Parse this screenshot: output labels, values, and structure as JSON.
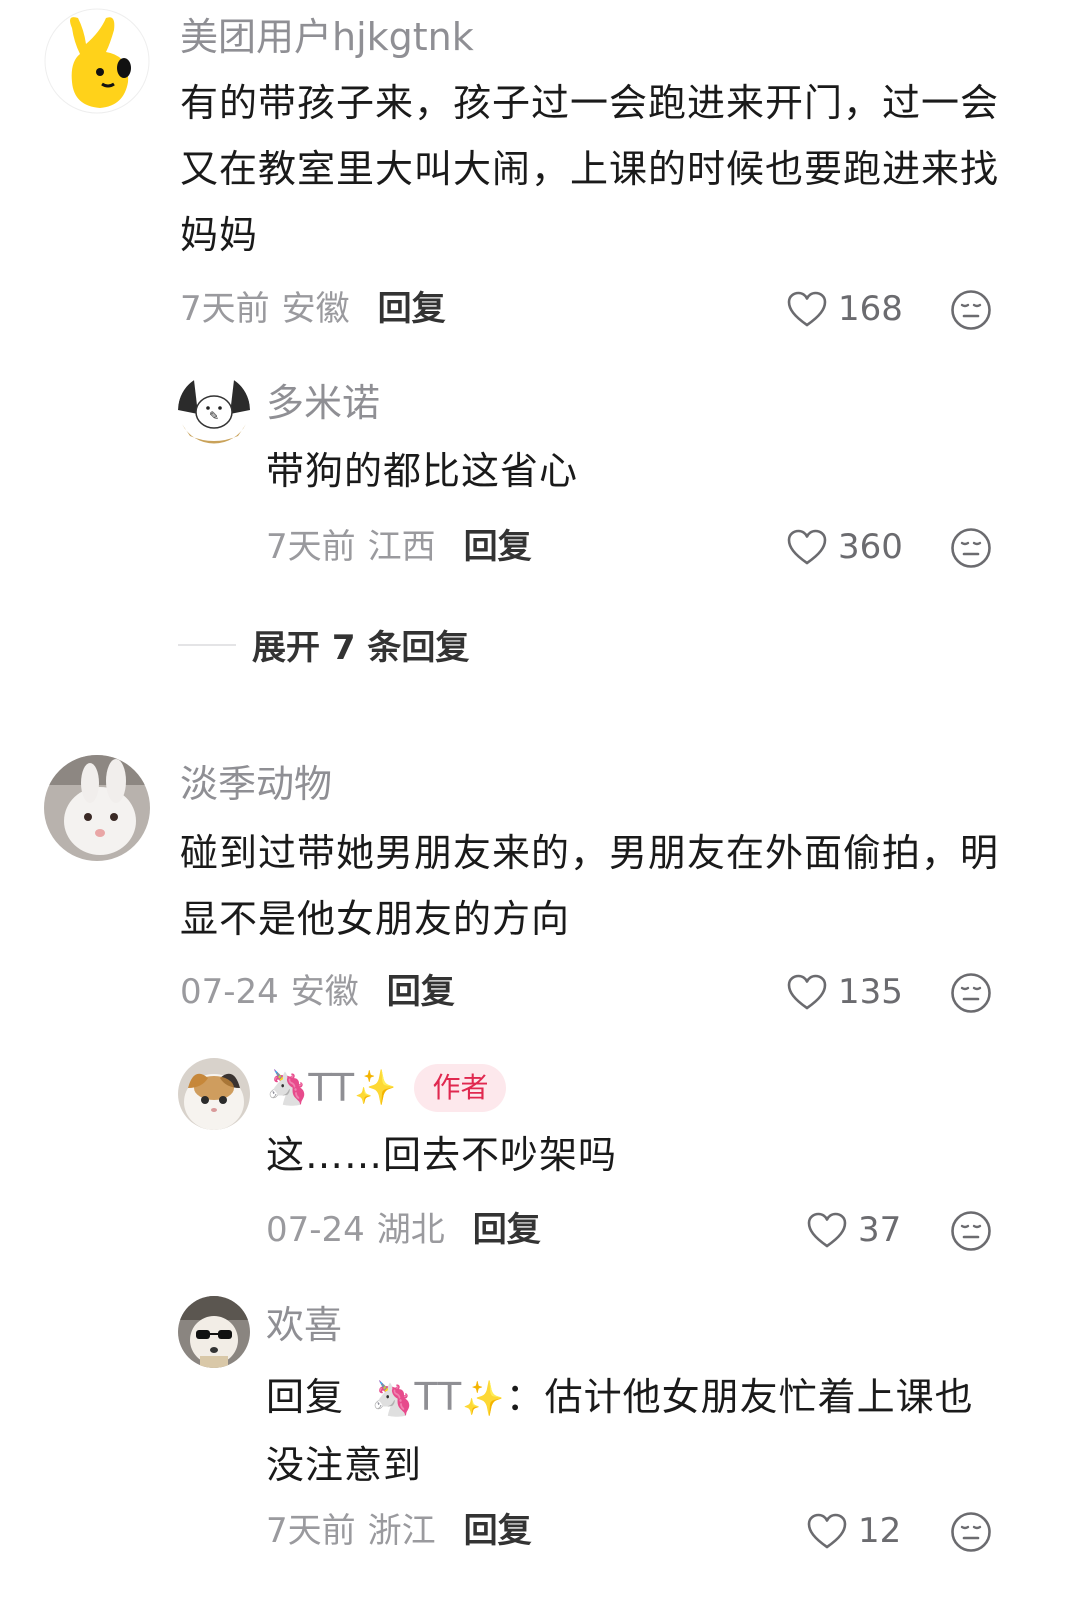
{
  "comments": [
    {
      "username": "美团用户hjkgtnk",
      "content": "有的带孩子来，孩子过一会跑进来开门，过一会又在教室里大叫大闹，上课的时候也要跑进来找妈妈",
      "time": "7天前",
      "location": "安徽",
      "reply_label": "回复",
      "likes": "168",
      "replies": [
        {
          "username": "多米诺",
          "content": "带狗的都比这省心",
          "time": "7天前",
          "location": "江西",
          "reply_label": "回复",
          "likes": "360"
        }
      ],
      "expand_label": "展开 7 条回复"
    },
    {
      "username": "淡季动物",
      "content": "碰到过带她男朋友来的，男朋友在外面偷拍，明显不是他女朋友的方向",
      "time": "07-24",
      "location": "安徽",
      "reply_label": "回复",
      "likes": "135",
      "replies": [
        {
          "username_emoji_left": "🦄",
          "username": "TT",
          "username_emoji_right": "✨",
          "author_tag": "作者",
          "content": "这……回去不吵架吗",
          "time": "07-24",
          "location": "湖北",
          "reply_label": "回复",
          "likes": "37"
        },
        {
          "username": "欢喜",
          "reply_prefix": "回复",
          "mention_emoji_left": "🦄",
          "mention_name": "TT",
          "mention_emoji_right": "✨",
          "mention_colon": "：",
          "content": "估计他女朋友忙着上课也没注意到",
          "time": "7天前",
          "location": "浙江",
          "reply_label": "回复",
          "likes": "12"
        }
      ]
    }
  ],
  "icons": {
    "like": "heart-outline-icon",
    "dislike": "meh-face-icon"
  },
  "colors": {
    "author_tag_bg": "#fde8ec",
    "author_tag_text": "#e0284f",
    "username": "#8f8f94",
    "meta": "#9a9a9e"
  }
}
